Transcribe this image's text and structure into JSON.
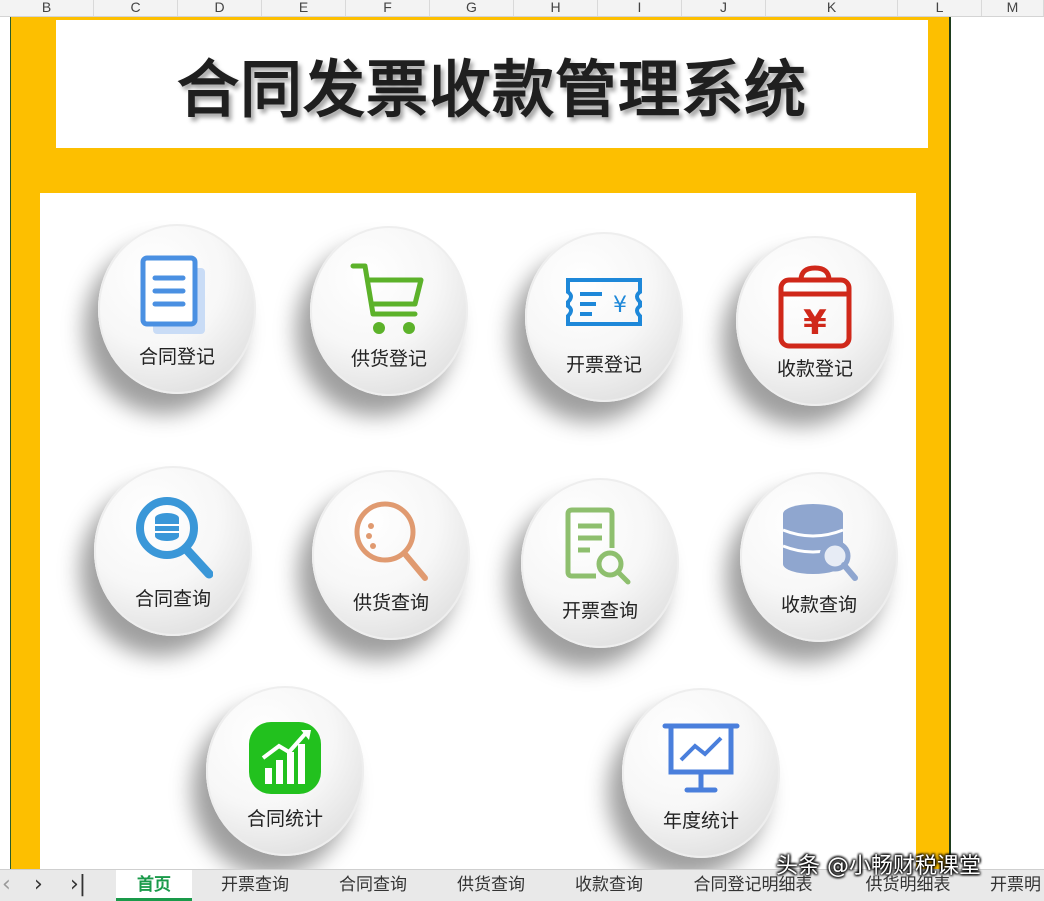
{
  "columns": [
    "B",
    "C",
    "D",
    "E",
    "F",
    "G",
    "H",
    "I",
    "J",
    "K",
    "L",
    "M"
  ],
  "title": "合同发票收款管理系统",
  "buttons": [
    {
      "label": "合同登记",
      "icon": "contract-doc-icon",
      "color": "#4a90e2"
    },
    {
      "label": "供货登记",
      "icon": "shopping-cart-icon",
      "color": "#5cb22a"
    },
    {
      "label": "开票登记",
      "icon": "invoice-ticket-icon",
      "color": "#1e88d9"
    },
    {
      "label": "收款登记",
      "icon": "money-bag-icon",
      "color": "#d0281a"
    },
    {
      "label": "合同查询",
      "icon": "magnifier-database-icon",
      "color": "#3a97d8"
    },
    {
      "label": "供货查询",
      "icon": "magnifier-icon",
      "color": "#e09a70"
    },
    {
      "label": "开票查询",
      "icon": "document-search-icon",
      "color": "#8ebf6e"
    },
    {
      "label": "收款查询",
      "icon": "database-search-icon",
      "color": "#8fa6cf"
    },
    {
      "label": "合同统计",
      "icon": "growth-chart-icon",
      "color": "#22c11e"
    },
    {
      "label": "年度统计",
      "icon": "presentation-board-icon",
      "color": "#4a7fdc"
    }
  ],
  "tabs": [
    "首页",
    "开票查询",
    "合同查询",
    "供货查询",
    "收款查询",
    "合同登记明细表",
    "供货明细表",
    "开票明"
  ],
  "active_tab": "首页",
  "nav": {
    "prev": "‹",
    "next": "›",
    "last": "›|"
  },
  "watermark": "头条 @小畅财税课堂"
}
